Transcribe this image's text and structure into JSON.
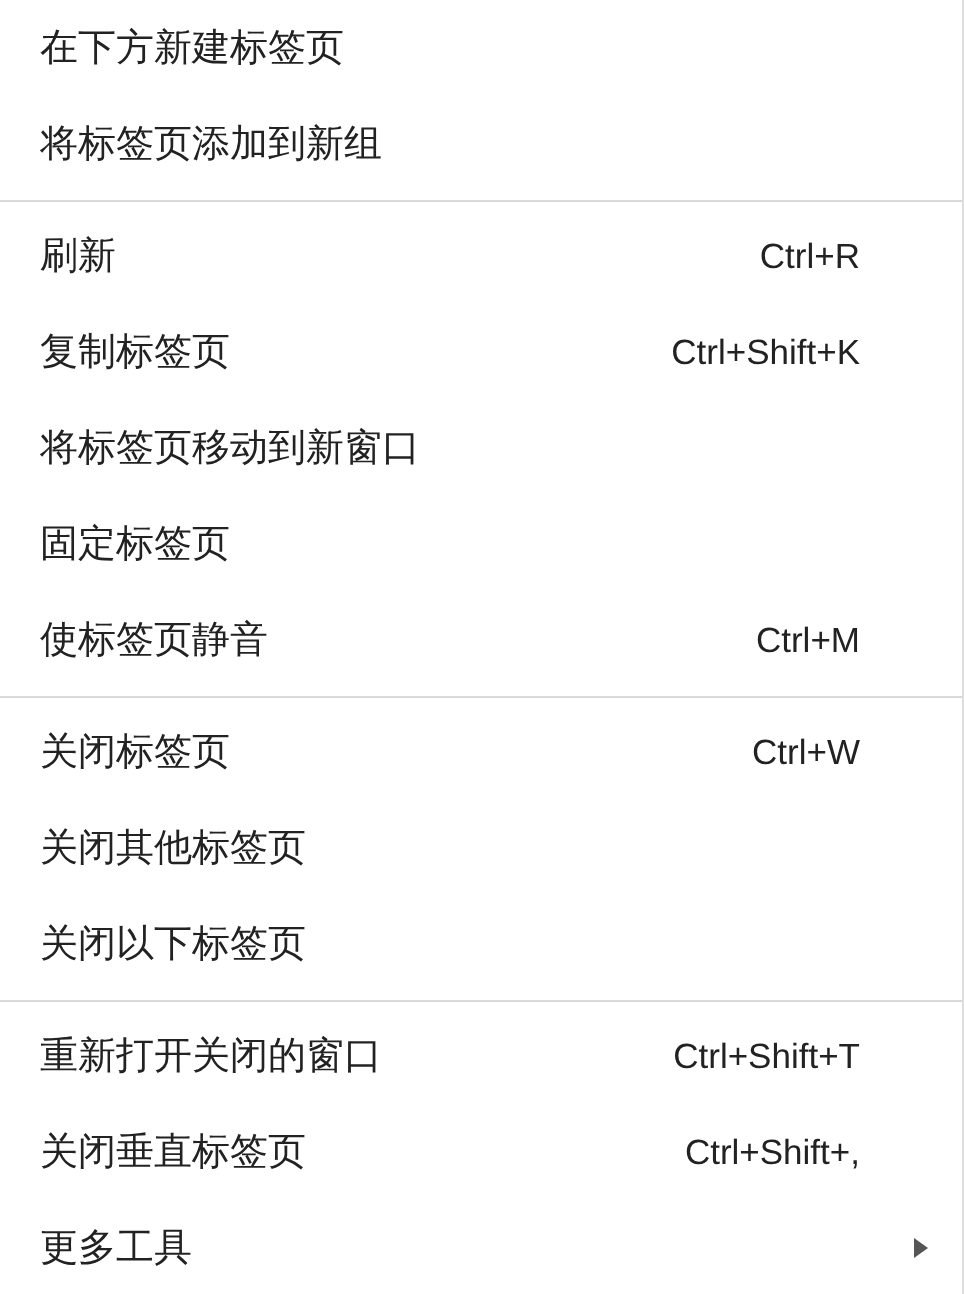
{
  "menu": {
    "groups": [
      {
        "items": [
          {
            "kind": "command",
            "label": "在下方新建标签页"
          },
          {
            "kind": "command",
            "label": "将标签页添加到新组"
          }
        ]
      },
      {
        "items": [
          {
            "kind": "command",
            "label": "刷新",
            "shortcut": "Ctrl+R"
          },
          {
            "kind": "command",
            "label": "复制标签页",
            "shortcut": "Ctrl+Shift+K"
          },
          {
            "kind": "command",
            "label": "将标签页移动到新窗口"
          },
          {
            "kind": "command",
            "label": "固定标签页"
          },
          {
            "kind": "command",
            "label": "使标签页静音",
            "shortcut": "Ctrl+M"
          }
        ]
      },
      {
        "items": [
          {
            "kind": "command",
            "label": "关闭标签页",
            "shortcut": "Ctrl+W"
          },
          {
            "kind": "command",
            "label": "关闭其他标签页"
          },
          {
            "kind": "command",
            "label": "关闭以下标签页"
          }
        ]
      },
      {
        "items": [
          {
            "kind": "command",
            "label": "重新打开关闭的窗口",
            "shortcut": "Ctrl+Shift+T"
          },
          {
            "kind": "command",
            "label": "关闭垂直标签页",
            "shortcut": "Ctrl+Shift+,"
          },
          {
            "kind": "submenu",
            "label": "更多工具"
          }
        ]
      }
    ]
  }
}
